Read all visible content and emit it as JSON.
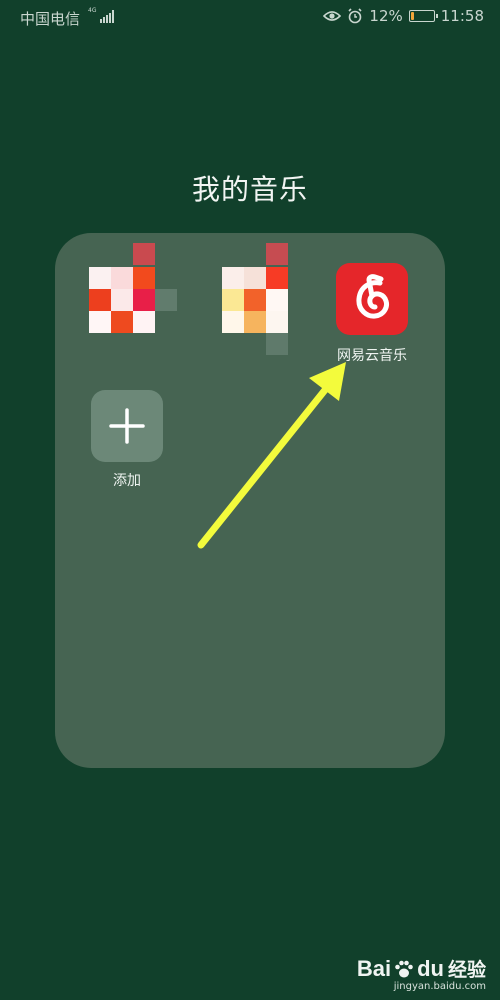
{
  "status_bar": {
    "carrier": "中国电信",
    "network": "4G",
    "battery_percent": "12%",
    "battery_level": 0.12,
    "time": "11:58",
    "icons": [
      "eye-icon",
      "alarm-icon",
      "battery-icon",
      "signal-icon"
    ]
  },
  "folder": {
    "title": "我的音乐",
    "apps": [
      {
        "label": "",
        "icon": "blurred-app-icon"
      },
      {
        "label": "",
        "icon": "blurred-app-icon"
      },
      {
        "label": "网易云音乐",
        "icon": "netease-cloud-music-icon"
      },
      {
        "label": "添加",
        "icon": "plus-icon"
      }
    ]
  },
  "annotation": {
    "arrow_color": "#f3fb3c"
  },
  "colors": {
    "background": "#11402b",
    "folder_panel": "#466452",
    "netease_red": "#e5262a"
  },
  "watermark": {
    "logo_text": "Bai",
    "logo_suffix": "du",
    "product": "经验",
    "url": "jingyan.baidu.com"
  }
}
